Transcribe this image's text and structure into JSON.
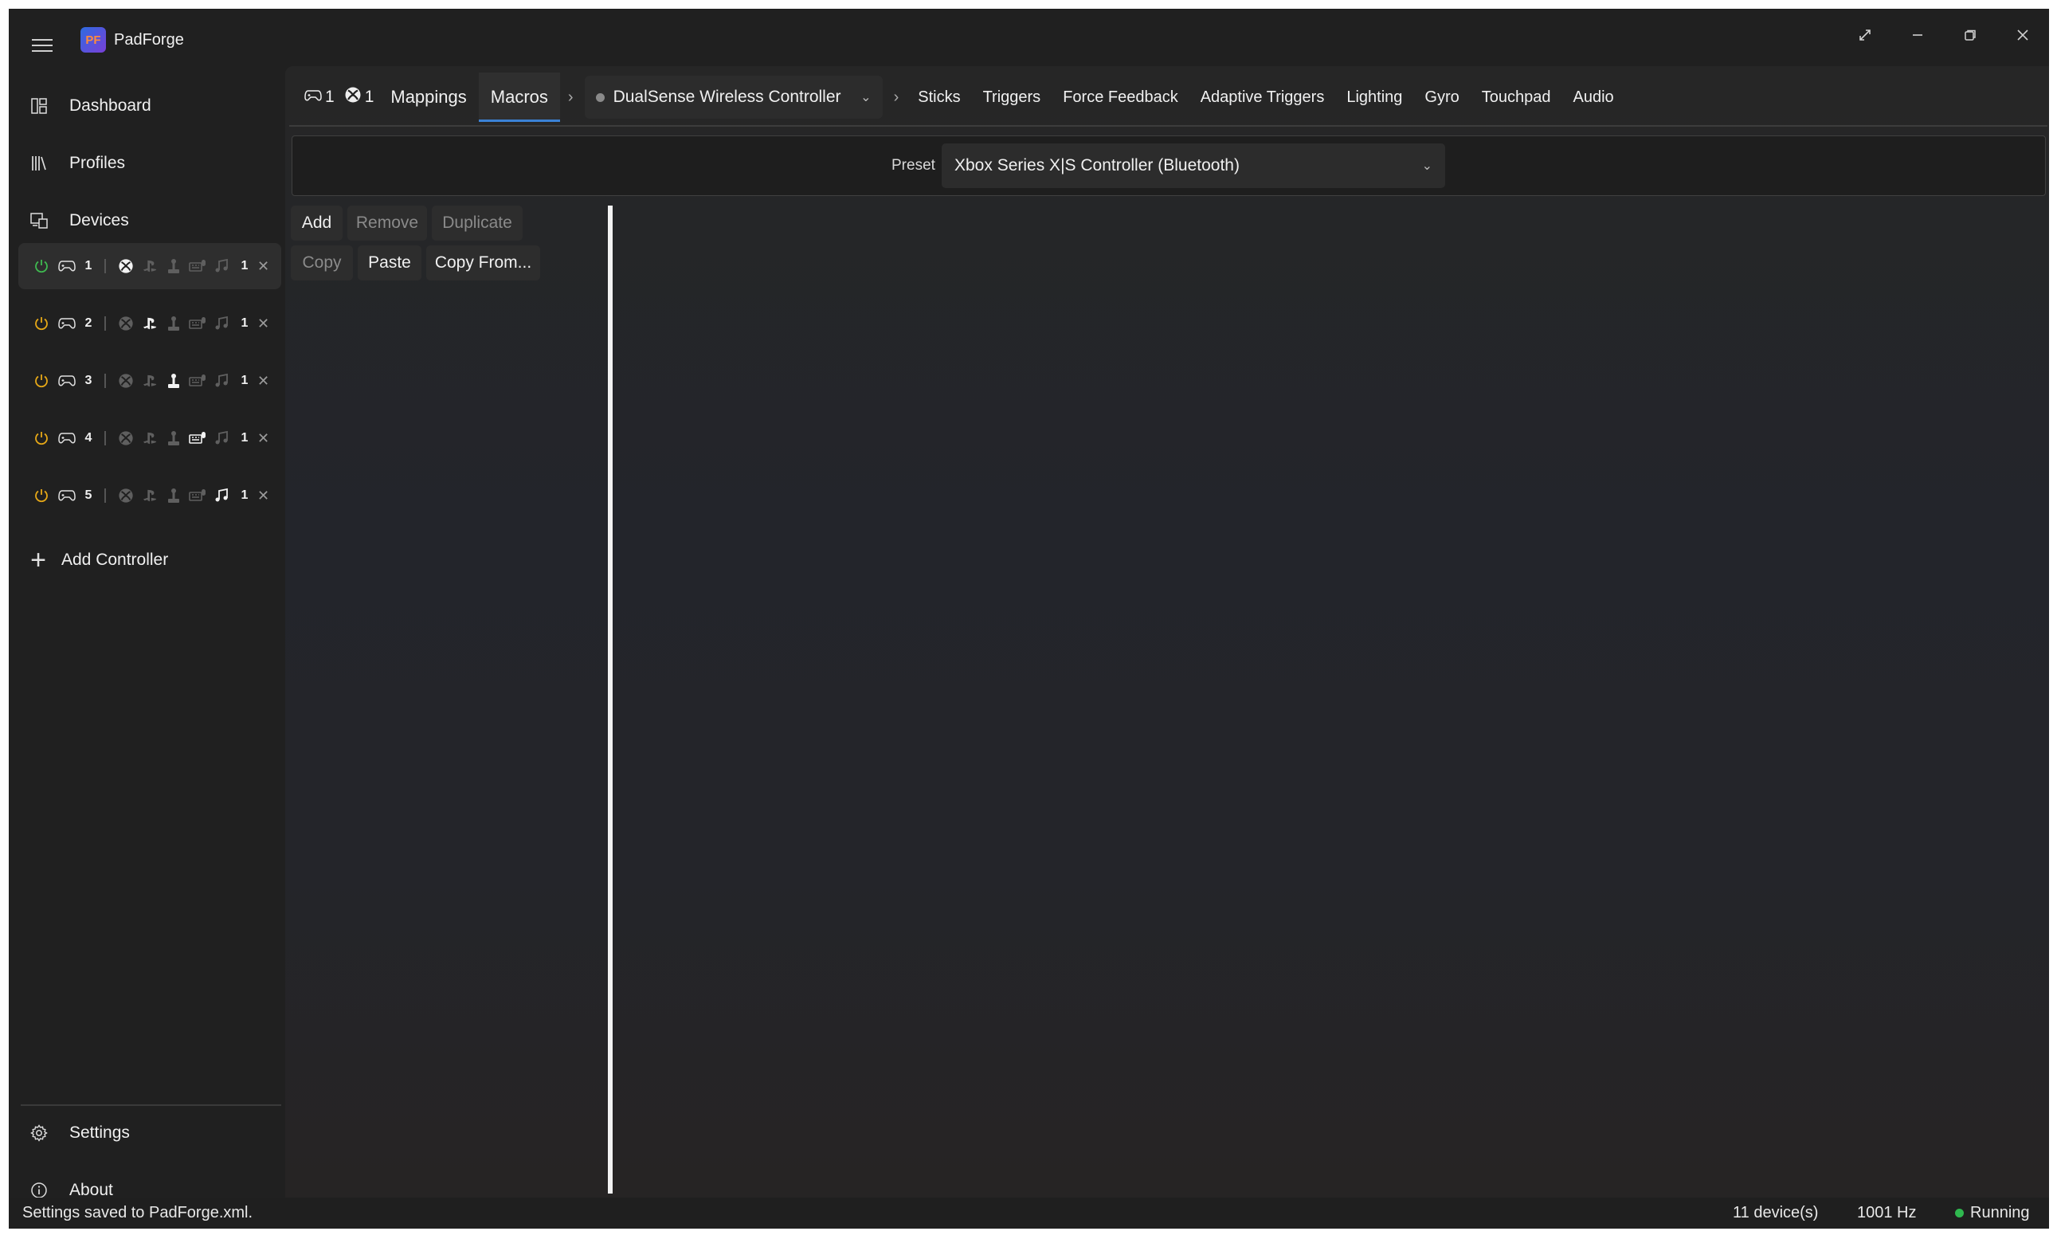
{
  "app": {
    "title": "PadForge",
    "logo_text": "PF"
  },
  "window_controls": [
    "expand-icon",
    "minimize-icon",
    "restore-icon",
    "close-icon"
  ],
  "nav": {
    "dashboard": "Dashboard",
    "profiles": "Profiles",
    "devices": "Devices",
    "add_controller": "Add Controller",
    "settings": "Settings",
    "about": "About"
  },
  "slots": [
    {
      "number": "1",
      "count": "1",
      "selected": true,
      "power_color": "#3fb950",
      "active_type": "xbox"
    },
    {
      "number": "2",
      "count": "1",
      "selected": false,
      "power_color": "#e6a817",
      "active_type": "playstation"
    },
    {
      "number": "3",
      "count": "1",
      "selected": false,
      "power_color": "#e6a817",
      "active_type": "generic-controller"
    },
    {
      "number": "4",
      "count": "1",
      "selected": false,
      "power_color": "#e6a817",
      "active_type": "keyboard-mouse"
    },
    {
      "number": "5",
      "count": "1",
      "selected": false,
      "power_color": "#e6a817",
      "active_type": "midi"
    }
  ],
  "tabs": {
    "badge_controllers": "1",
    "badge_xbox": "1",
    "mappings": "Mappings",
    "macros": "Macros",
    "device": "DualSense Wireless Controller",
    "sticks": "Sticks",
    "triggers": "Triggers",
    "force_feedback": "Force Feedback",
    "adaptive_triggers": "Adaptive Triggers",
    "lighting": "Lighting",
    "gyro": "Gyro",
    "touchpad": "Touchpad",
    "audio": "Audio"
  },
  "preset": {
    "label": "Preset",
    "value": "Xbox Series X|S Controller (Bluetooth)"
  },
  "macro_buttons": {
    "add": "Add",
    "remove": "Remove",
    "duplicate": "Duplicate",
    "copy": "Copy",
    "paste": "Paste",
    "copy_from": "Copy From..."
  },
  "status": {
    "message": "Settings saved to PadForge.xml.",
    "devices": "11 device(s)",
    "rate": "1001 Hz",
    "state": "Running"
  },
  "colors": {
    "accent": "#3b82d6",
    "running": "#2fb84f",
    "power_on": "#3fb950",
    "power_idle": "#e6a817"
  }
}
